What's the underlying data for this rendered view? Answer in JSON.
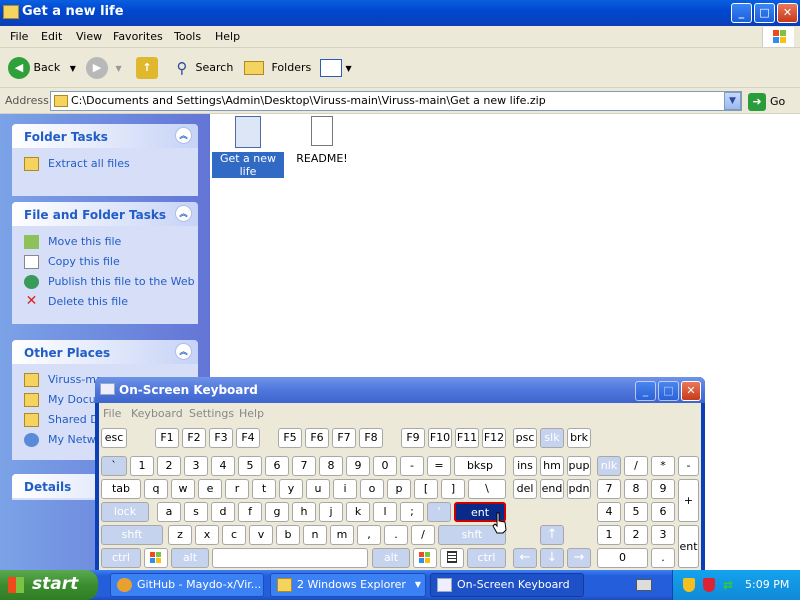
{
  "window": {
    "title": "Get a new life",
    "minimize": "_",
    "maximize": "□",
    "close": "✕"
  },
  "menu": [
    "File",
    "Edit",
    "View",
    "Favorites",
    "Tools",
    "Help"
  ],
  "toolbar": {
    "back": "Back",
    "search": "Search",
    "folders": "Folders"
  },
  "address": {
    "label": "Address",
    "path": "C:\\Documents and Settings\\Admin\\Desktop\\Viruss-main\\Viruss-main\\Get a new life.zip",
    "go": "Go"
  },
  "left_pane": {
    "folder_tasks": {
      "title": "Folder Tasks",
      "items": [
        "Extract all files"
      ]
    },
    "file_folder_tasks": {
      "title": "File and Folder Tasks",
      "items": [
        "Move this file",
        "Copy this file",
        "Publish this file to the Web",
        "Delete this file"
      ]
    },
    "other_places": {
      "title": "Other Places",
      "items": [
        "Viruss-ma",
        "My Docum",
        "Shared Do",
        "My Netwo"
      ]
    },
    "details": {
      "title": "Details"
    }
  },
  "files": [
    {
      "name": "Get a new life",
      "selected": true
    },
    {
      "name": "README!",
      "selected": false
    }
  ],
  "osk": {
    "title": "On-Screen Keyboard",
    "menu": [
      "File",
      "Keyboard",
      "Settings",
      "Help"
    ],
    "keys": {
      "esc": "esc",
      "f1": "F1",
      "f2": "F2",
      "f3": "F3",
      "f4": "F4",
      "f5": "F5",
      "f6": "F6",
      "f7": "F7",
      "f8": "F8",
      "f9": "F9",
      "f10": "F10",
      "f11": "F11",
      "f12": "F12",
      "psc": "psc",
      "slk": "slk",
      "brk": "brk",
      "tilde": "`",
      "n1": "1",
      "n2": "2",
      "n3": "3",
      "n4": "4",
      "n5": "5",
      "n6": "6",
      "n7": "7",
      "n8": "8",
      "n9": "9",
      "n0": "0",
      "minus": "-",
      "equals": "=",
      "bksp": "bksp",
      "ins": "ins",
      "hm": "hm",
      "pup": "pup",
      "nlk": "nlk",
      "kpdiv": "/",
      "kpmul": "*",
      "kpsub": "-",
      "tab": "tab",
      "q": "q",
      "w": "w",
      "e": "e",
      "r": "r",
      "t": "t",
      "y": "y",
      "u": "u",
      "i": "i",
      "o": "o",
      "p": "p",
      "lbr": "[",
      "rbr": "]",
      "bslash": "\\",
      "del": "del",
      "end": "end",
      "pdn": "pdn",
      "kp7": "7",
      "kp8": "8",
      "kp9": "9",
      "kpadd": "+",
      "lock": "lock",
      "a": "a",
      "s": "s",
      "d": "d",
      "f": "f",
      "g": "g",
      "h": "h",
      "j": "j",
      "k": "k",
      "l": "l",
      "semi": ";",
      "quote": "'",
      "ent": "ent",
      "kp4": "4",
      "kp5": "5",
      "kp6": "6",
      "shft": "shft",
      "z": "z",
      "x": "x",
      "c": "c",
      "v": "v",
      "b": "b",
      "n": "n",
      "m": "m",
      "comma": ",",
      "period": ".",
      "slash": "/",
      "shft2": "shft",
      "up": "↑",
      "kp1": "1",
      "kp2": "2",
      "kp3": "3",
      "kpent": "ent",
      "ctrl": "ctrl",
      "alt": "alt",
      "space": "",
      "alt2": "alt",
      "ctrl2": "ctrl",
      "left": "←",
      "down": "↓",
      "right": "→",
      "kp0": "0",
      "kpdot": "."
    }
  },
  "taskbar": {
    "start": "start",
    "tasks": [
      "GitHub - Maydo-x/Vir...",
      "2 Windows Explorer",
      "On-Screen Keyboard"
    ],
    "clock": "5:09 PM"
  }
}
